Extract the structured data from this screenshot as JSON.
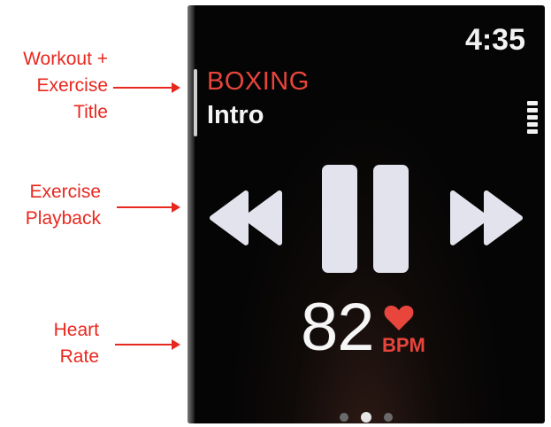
{
  "annotations": {
    "workout": [
      "Workout +",
      "Exercise",
      "Title"
    ],
    "playback": [
      "Exercise",
      "Playback"
    ],
    "heart": [
      "Heart",
      "Rate"
    ]
  },
  "screen": {
    "time": "4:35",
    "workout_title": "BOXING",
    "exercise_title": "Intro",
    "heart_rate": "82",
    "heart_rate_unit": "BPM",
    "page_count": 3,
    "active_page": 2
  },
  "colors": {
    "accent_red": "#e8453c",
    "annotation_red": "#e8281f",
    "screen_bg": "#050505",
    "control_fill": "#e3e3ee"
  },
  "icons": [
    "rewind-icon",
    "pause-icon",
    "fast-forward-icon",
    "heart-icon",
    "menu-icon"
  ]
}
